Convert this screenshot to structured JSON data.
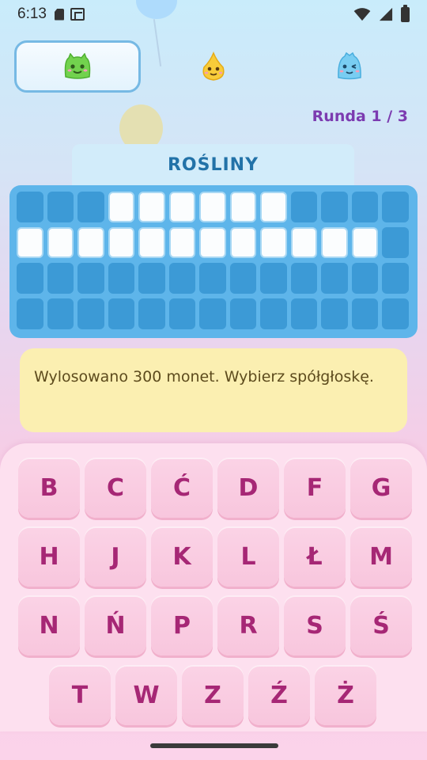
{
  "status_bar": {
    "time": "6:13",
    "icons": [
      "sd-card-icon",
      "screenshot-icon",
      "wifi-icon",
      "signal-icon",
      "battery-icon"
    ]
  },
  "players": [
    {
      "avatar": "green-slime-icon",
      "color": "#6ed04a",
      "active": true
    },
    {
      "avatar": "yellow-drop-icon",
      "color": "#f7c93a",
      "active": false
    },
    {
      "avatar": "blue-ghost-icon",
      "color": "#6ec7ef",
      "active": false
    }
  ],
  "round": {
    "label": "Runda 1 / 3"
  },
  "category": {
    "label": "ROŚLINY"
  },
  "board": {
    "rows": [
      [
        0,
        0,
        0,
        1,
        1,
        1,
        1,
        1,
        1,
        0,
        0,
        0,
        0
      ],
      [
        1,
        1,
        1,
        1,
        1,
        1,
        1,
        1,
        1,
        1,
        1,
        1,
        0
      ],
      [
        0,
        0,
        0,
        0,
        0,
        0,
        0,
        0,
        0,
        0,
        0,
        0,
        0
      ],
      [
        0,
        0,
        0,
        0,
        0,
        0,
        0,
        0,
        0,
        0,
        0,
        0,
        0
      ]
    ]
  },
  "message": {
    "text": "Wylosowano 300 monet. Wybierz spółgłoskę."
  },
  "keyboard": {
    "rows": [
      [
        "B",
        "C",
        "Ć",
        "D",
        "F",
        "G"
      ],
      [
        "H",
        "J",
        "K",
        "L",
        "Ł",
        "M"
      ],
      [
        "N",
        "Ń",
        "P",
        "R",
        "S",
        "Ś"
      ],
      [
        "T",
        "W",
        "Z",
        "Ź",
        "Ż"
      ]
    ]
  },
  "colors": {
    "accent_purple": "#7c3bb0",
    "category_text": "#2272a8",
    "board_bg": "#5eb5ea",
    "key_text": "#a62775",
    "message_bg": "#fbefb1"
  }
}
